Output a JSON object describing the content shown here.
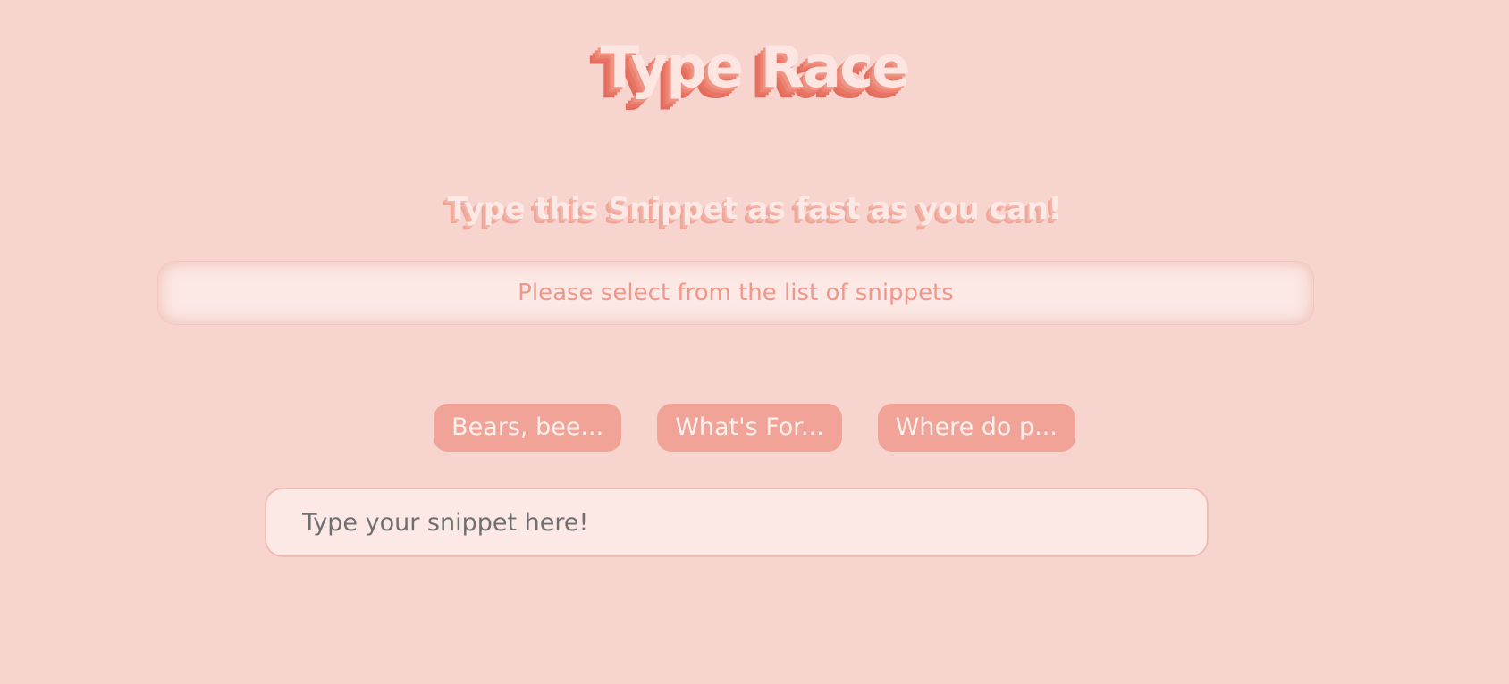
{
  "header": {
    "title": "Type Race",
    "subtitle": "Type this Snippet as fast as you can!"
  },
  "snippet_display": {
    "text": "Please select from the list of snippets"
  },
  "snippets": [
    {
      "label": "Bears, bee..."
    },
    {
      "label": "What's For..."
    },
    {
      "label": "Where do p..."
    }
  ],
  "input": {
    "value": "",
    "placeholder": "Type your snippet here!"
  },
  "colors": {
    "background": "#f7d4ce",
    "accent": "#f1a397",
    "title_shadow": "#e46c5c"
  }
}
